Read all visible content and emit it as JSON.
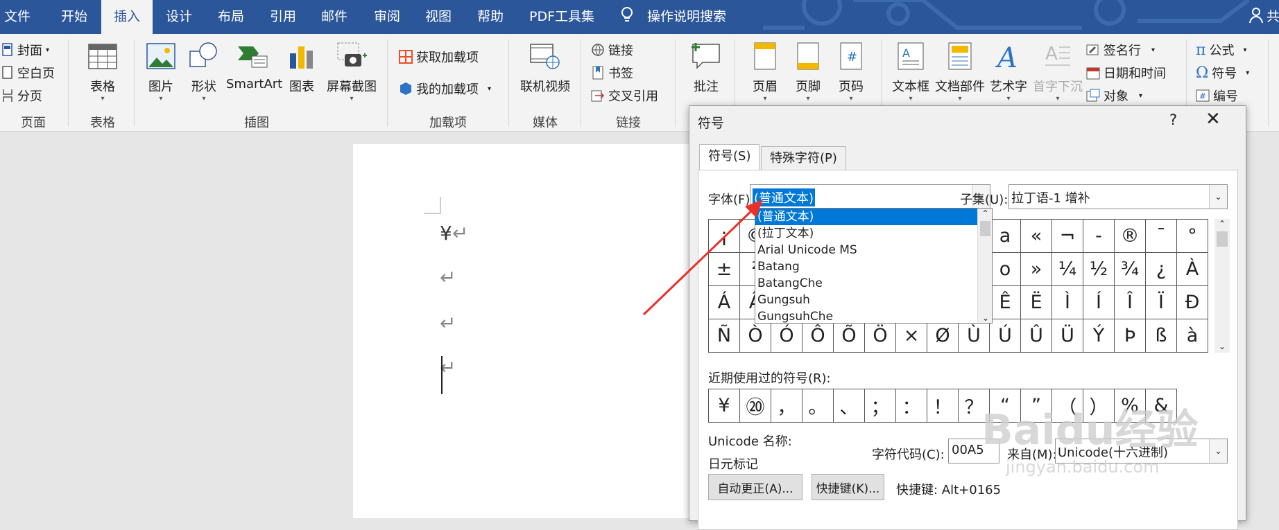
{
  "menu_tabs": [
    "文件",
    "开始",
    "插入",
    "设计",
    "布局",
    "引用",
    "邮件",
    "审阅",
    "视图",
    "帮助",
    "PDF工具集"
  ],
  "search_text": "操作说明搜索",
  "user_initial": "共",
  "ribbon": {
    "pages": {
      "cover": "封面",
      "blank": "空白页",
      "break": "分页",
      "group": "页面"
    },
    "table": {
      "label": "表格",
      "group": "表格"
    },
    "illustrations": {
      "picture": "图片",
      "shapes": "形状",
      "smartart": "SmartArt",
      "chart": "图表",
      "screenshot": "屏幕截图",
      "group": "插图"
    },
    "addins": {
      "get": "获取加载项",
      "my": "我的加载项",
      "group": "加载项"
    },
    "media": {
      "online_video": "联机视频",
      "group": "媒体"
    },
    "links": {
      "link": "链接",
      "bookmark": "书签",
      "crossref": "交叉引用",
      "group": "链接"
    },
    "comments": {
      "comment": "批注"
    },
    "header_footer": {
      "header": "页眉",
      "footer": "页脚",
      "page_number": "页码"
    },
    "text": {
      "textbox": "文本框",
      "quickparts": "文档部件",
      "wordart": "艺术字",
      "dropcap": "首字下沉",
      "signature": "签名行",
      "datetime": "日期和时间",
      "object": "对象"
    },
    "symbols": {
      "equation": "公式",
      "symbol": "符号",
      "number": "编号"
    }
  },
  "document": {
    "paragraphs": [
      "¥",
      "",
      "",
      ""
    ],
    "para_mark": "↵"
  },
  "dialog": {
    "title": "符号",
    "help": "?",
    "tabs": [
      "符号(S)",
      "特殊字符(P)"
    ],
    "font_label": "字体(F):",
    "font_value": "(普通文本)",
    "subset_label": "子集(U):",
    "subset_value": "拉丁语-1 增补",
    "font_options": [
      "(普通文本)",
      "(拉丁文本)",
      "Arial Unicode MS",
      "Batang",
      "BatangChe",
      "Gungsuh",
      "GungsuhChe"
    ],
    "symbol_rows": [
      [
        "¡",
        "©",
        "",
        "",
        "",
        "",
        "",
        "",
        "",
        "a",
        "«",
        "¬",
        "-",
        "®",
        "¯",
        "°"
      ],
      [
        "±",
        "²",
        "",
        "",
        "",
        "",
        "",
        "",
        "",
        "o",
        "»",
        "¼",
        "½",
        "¾",
        "¿",
        "À"
      ],
      [
        "Á",
        "Â",
        "",
        "",
        "",
        "",
        "",
        "",
        "",
        "Ê",
        "Ë",
        "Ì",
        "Í",
        "Î",
        "Ï",
        "Ð"
      ],
      [
        "Ñ",
        "Ò",
        "Ó",
        "Ô",
        "Õ",
        "Ö",
        "×",
        "Ø",
        "Ù",
        "Ú",
        "Û",
        "Ü",
        "Ý",
        "Þ",
        "ß",
        "à"
      ]
    ],
    "recent_label": "近期使用过的符号(R):",
    "recent": [
      "¥",
      "⑳",
      "，",
      "。",
      "、",
      "；",
      "：",
      "！",
      "？",
      "“",
      "”",
      "（",
      "）",
      "%",
      "&"
    ],
    "unicode_name_label": "Unicode 名称:",
    "unicode_name": "日元标记",
    "charcode_label": "字符代码(C):",
    "charcode": "00A5",
    "from_label": "来自(M):",
    "from_value": "Unicode(十六进制)",
    "autocorrect": "自动更正(A)...",
    "shortcut_btn": "快捷键(K)...",
    "shortcut_text": "快捷键: Alt+0165"
  },
  "watermark": {
    "brand": "Baidu经验",
    "url": "jingyan.baidu.com"
  },
  "colors": {
    "ribbon_blue": "#2b579a",
    "selection": "#0078d7",
    "arrow": "#e8302a"
  }
}
